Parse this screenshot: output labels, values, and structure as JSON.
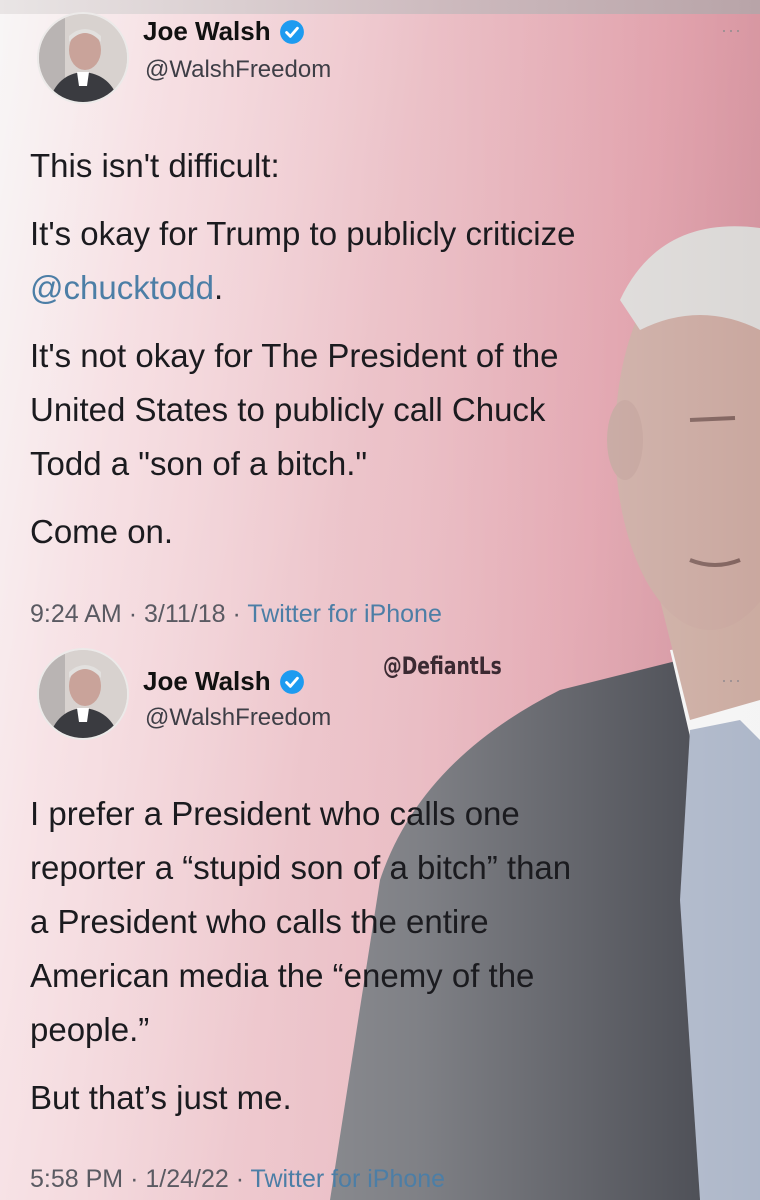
{
  "tweets": [
    {
      "author": {
        "display_name": "Joe Walsh",
        "handle": "@WalshFreedom"
      },
      "body": {
        "p1": "This isn't difficult:",
        "p2_text": "It's okay for Trump to publicly criticize ",
        "p2_mention": "@chucktodd",
        "p2_end": ".",
        "p3_line1": "It's not okay for The President of the",
        "p3_line2": "United States to publicly call Chuck",
        "p3_line3": "Todd a \"son of a bitch.\"",
        "p4": "Come on."
      },
      "time": "9:24 AM",
      "date": "3/11/18",
      "source": "Twitter for iPhone",
      "separator": "·",
      "more": "···"
    },
    {
      "author": {
        "display_name": "Joe Walsh",
        "handle": "@WalshFreedom"
      },
      "watermark": "@DefiantLs",
      "body": {
        "p1_line1": "I prefer a President who calls one",
        "p1_line2": "reporter a “stupid son of a bitch” than",
        "p1_line3": "a President who calls the entire",
        "p1_line4": "American media the “enemy of the",
        "p1_line5": "people.”",
        "p2": "But that’s just me."
      },
      "time": "5:58 PM",
      "date": "1/24/22",
      "source": "Twitter for iPhone",
      "separator": "·",
      "more": "···"
    }
  ],
  "colors": {
    "background_accent": "#dd95a1",
    "link": "#4c7ea6",
    "verified": "#1d9bf0"
  },
  "icons": {
    "verified": "verified-badge-icon",
    "more": "more-dots-icon"
  }
}
